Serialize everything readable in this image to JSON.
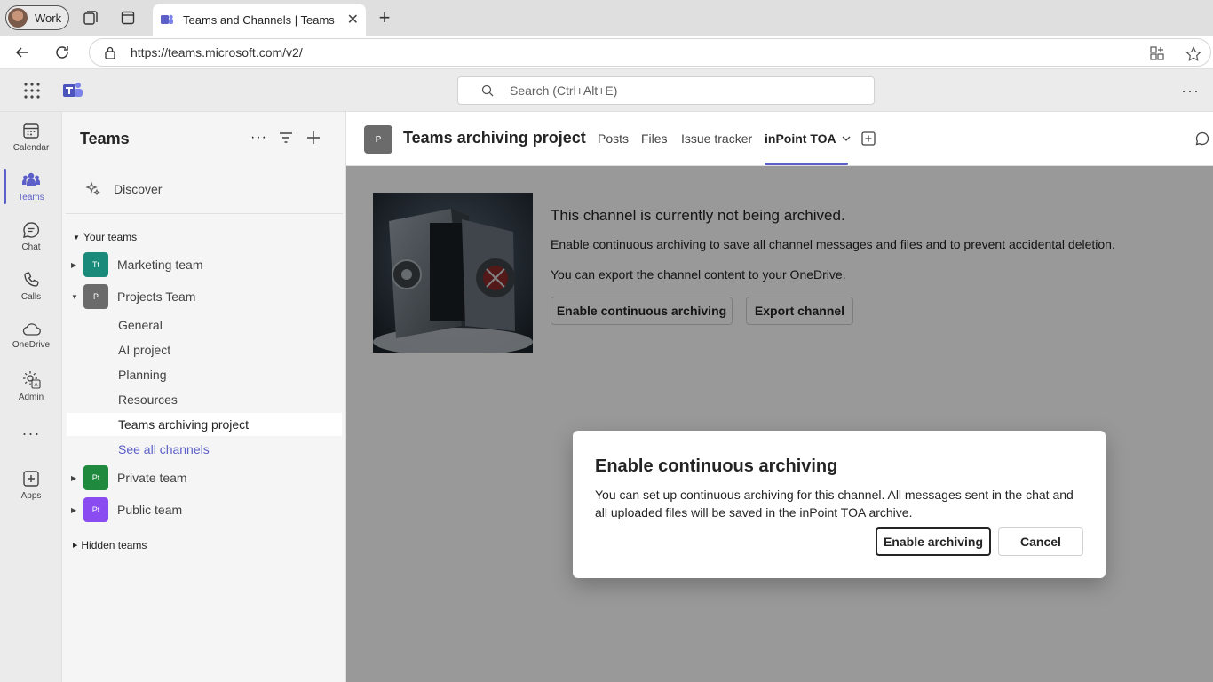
{
  "browser": {
    "profile_label": "Work",
    "tab_title": "Teams and Channels | Teams archiving",
    "url": "https://teams.microsoft.com/v2/"
  },
  "teams_bar": {
    "search_placeholder": "Search (Ctrl+Alt+E)"
  },
  "rail": {
    "items": [
      {
        "label": "Calendar",
        "icon": "calendar-icon"
      },
      {
        "label": "Teams",
        "icon": "teams-icon"
      },
      {
        "label": "Chat",
        "icon": "chat-icon"
      },
      {
        "label": "Calls",
        "icon": "calls-icon"
      },
      {
        "label": "OneDrive",
        "icon": "cloud-icon"
      },
      {
        "label": "Admin",
        "icon": "admin-icon"
      },
      {
        "label": "Apps",
        "icon": "apps-icon"
      }
    ]
  },
  "teams_pane": {
    "title": "Teams",
    "discover": "Discover",
    "your_teams": "Your teams",
    "hidden_teams": "Hidden teams",
    "teams": [
      {
        "name": "Marketing team",
        "initials": "Tt",
        "color": "#1a8a7a"
      },
      {
        "name": "Projects Team",
        "initials": "P",
        "color": "#6b6b6b"
      },
      {
        "name": "Private team",
        "initials": "Pt",
        "color": "#1f8a3e"
      },
      {
        "name": "Public team",
        "initials": "Pt",
        "color": "#8a4cf0"
      }
    ],
    "channels": [
      "General",
      "AI project",
      "Planning",
      "Resources",
      "Teams archiving project"
    ],
    "see_all": "See all channels"
  },
  "header": {
    "avatar_initial": "P",
    "title": "Teams archiving project",
    "tabs": [
      "Posts",
      "Files",
      "Issue tracker",
      "inPoint TOA"
    ]
  },
  "content": {
    "status_title": "This channel is currently not being archived.",
    "line1": "Enable continuous archiving to save all channel messages and files and to prevent accidental deletion.",
    "line2": "You can export the channel content to your OneDrive.",
    "btn_enable": "Enable continuous archiving",
    "btn_export": "Export channel"
  },
  "dialog": {
    "title": "Enable continuous archiving",
    "body": "You can set up continuous archiving for this channel. All messages sent in the chat and all uploaded files will be saved in the inPoint TOA archive.",
    "confirm": "Enable archiving",
    "cancel": "Cancel"
  },
  "colors": {
    "accent": "#5b5fc7"
  }
}
